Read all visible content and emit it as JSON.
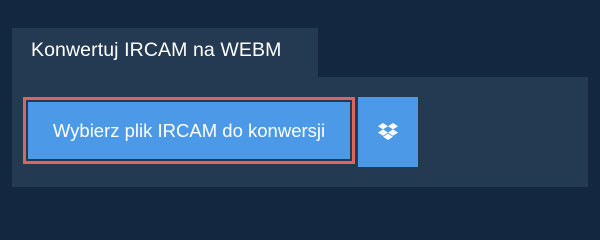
{
  "tab": {
    "title": "Konwertuj IRCAM na WEBM"
  },
  "upload": {
    "select_label": "Wybierz plik IRCAM do konwersji",
    "dropbox_icon": "dropbox-icon"
  },
  "colors": {
    "background": "#132840",
    "panel": "#233a52",
    "button": "#4c9ae7",
    "focus_border": "#d9675f"
  }
}
